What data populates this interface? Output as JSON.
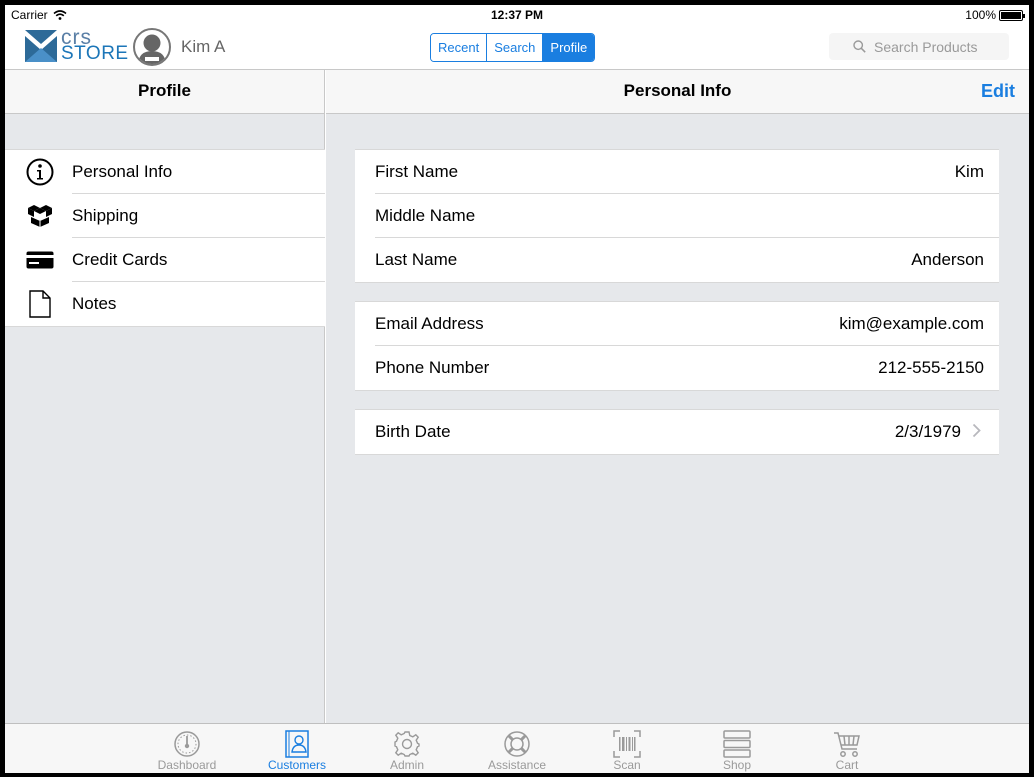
{
  "status_bar": {
    "carrier": "Carrier",
    "time": "12:37 PM",
    "battery": "100%"
  },
  "header": {
    "logo_top": "crs",
    "logo_bottom": "STORE",
    "user_name": "Kim A",
    "segments": [
      {
        "label": "Recent",
        "active": false
      },
      {
        "label": "Search",
        "active": false
      },
      {
        "label": "Profile",
        "active": true
      }
    ],
    "search_placeholder": "Search Products"
  },
  "sidebar": {
    "title": "Profile",
    "items": [
      {
        "label": "Personal Info",
        "icon": "info-icon"
      },
      {
        "label": "Shipping",
        "icon": "boxes-icon"
      },
      {
        "label": "Credit Cards",
        "icon": "credit-card-icon"
      },
      {
        "label": "Notes",
        "icon": "document-icon"
      }
    ]
  },
  "detail": {
    "title": "Personal Info",
    "edit_label": "Edit",
    "name_group": [
      {
        "label": "First Name",
        "value": "Kim"
      },
      {
        "label": "Middle Name",
        "value": ""
      },
      {
        "label": "Last Name",
        "value": "Anderson"
      }
    ],
    "contact_group": [
      {
        "label": "Email Address",
        "value": "kim@example.com"
      },
      {
        "label": "Phone Number",
        "value": "212-555-2150"
      }
    ],
    "birth_group": [
      {
        "label": "Birth Date",
        "value": "2/3/1979"
      }
    ]
  },
  "tabbar": {
    "tabs": [
      {
        "label": "Dashboard",
        "icon": "gauge-icon",
        "active": false
      },
      {
        "label": "Customers",
        "icon": "contacts-book-icon",
        "active": true
      },
      {
        "label": "Admin",
        "icon": "gear-icon",
        "active": false
      },
      {
        "label": "Assistance",
        "icon": "lifebuoy-icon",
        "active": false
      },
      {
        "label": "Scan",
        "icon": "barcode-icon",
        "active": false
      },
      {
        "label": "Shop",
        "icon": "list-icon",
        "active": false
      },
      {
        "label": "Cart",
        "icon": "cart-icon",
        "active": false
      }
    ]
  },
  "colors": {
    "accent": "#1a7ee0",
    "inactive": "#9a9a9a",
    "background": "#e6e8eb"
  }
}
